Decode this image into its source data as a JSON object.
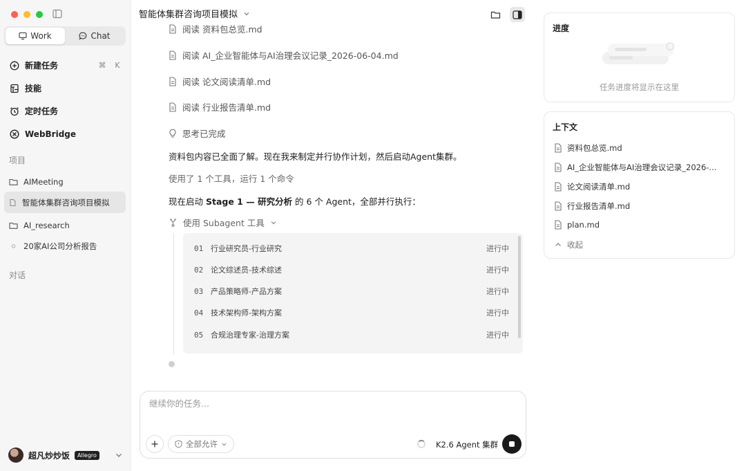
{
  "sidebar": {
    "tabs": [
      {
        "label": "Work",
        "icon": "monitor-icon",
        "active": true
      },
      {
        "label": "Chat",
        "icon": "chat-bubble-icon",
        "active": false
      }
    ],
    "nav": [
      {
        "label": "新建任务",
        "icon": "plus-circle-icon",
        "shortcut": [
          "⌘",
          "K"
        ]
      },
      {
        "label": "技能",
        "icon": "skills-icon"
      },
      {
        "label": "定时任务",
        "icon": "alarm-clock-icon"
      },
      {
        "label": "WebBridge",
        "icon": "webbridge-icon"
      }
    ],
    "projects_label": "项目",
    "projects": [
      {
        "label": "AIMeeting",
        "icon": "folder-icon"
      },
      {
        "label": "智能体集群咨询项目模拟",
        "icon": "file-icon",
        "active": true
      },
      {
        "label": "AI_research",
        "icon": "folder-icon"
      },
      {
        "label": "20家AI公司分析报告",
        "icon": "dot-icon"
      }
    ],
    "chats_label": "对话",
    "user": {
      "name": "超凡炒炒饭",
      "badge": "Allegro"
    }
  },
  "header": {
    "title": "智能体集群咨询项目模拟"
  },
  "feed": {
    "reads": [
      "阅读 资料包总览.md",
      "阅读 AI_企业智能体与AI治理会议记录_2026-06-04.md",
      "阅读 论文阅读清单.md",
      "阅读 行业报告清单.md"
    ],
    "thinking": "思考已完成",
    "message1": "资料包内容已全面了解。现在我来制定并行协作计划，然后启动Agent集群。",
    "tools_used": "使用了 1 个工具，运行 1 个命令",
    "stage_prefix": "现在启动 ",
    "stage_bold": "Stage 1 — 研究分析",
    "stage_suffix": " 的 6 个 Agent，全部并行执行：",
    "subagent_label": "使用 Subagent 工具",
    "agents": [
      {
        "idx": "01",
        "name": "行业研究员-行业研究",
        "status": "进行中"
      },
      {
        "idx": "02",
        "name": "论文综述员-技术综述",
        "status": "进行中"
      },
      {
        "idx": "03",
        "name": "产品策略师-产品方案",
        "status": "进行中"
      },
      {
        "idx": "04",
        "name": "技术架构师-架构方案",
        "status": "进行中"
      },
      {
        "idx": "05",
        "name": "合规治理专家-治理方案",
        "status": "进行中"
      }
    ]
  },
  "composer": {
    "placeholder": "继续你的任务...",
    "permission": "全部允许",
    "model": "K2.6 Agent 集群"
  },
  "progress": {
    "title": "进度",
    "empty": "任务进度将显示在这里"
  },
  "context": {
    "title": "上下文",
    "files": [
      "资料包总览.md",
      "AI_企业智能体与AI治理会议记录_2026-...",
      "论文阅读清单.md",
      "行业报告清单.md",
      "plan.md"
    ],
    "collapse": "收起"
  }
}
